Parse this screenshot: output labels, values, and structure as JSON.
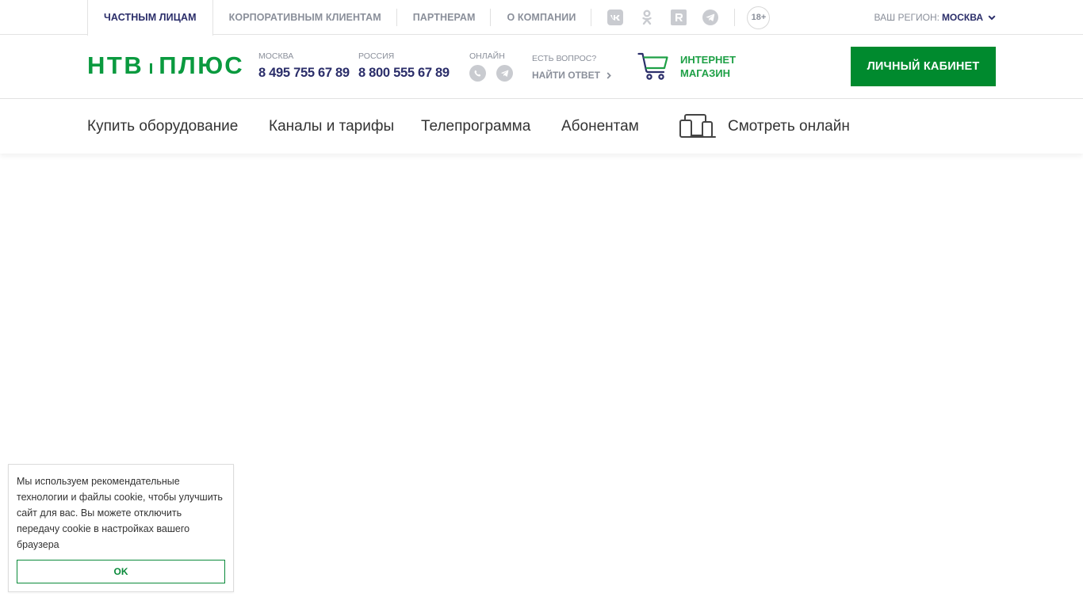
{
  "colors": {
    "brand_green": "#0a9a3f",
    "button_green": "#008a2e",
    "navy": "#2b2e6a",
    "muted": "#8a8f9a"
  },
  "topbar": {
    "nav": [
      {
        "label": "Частным лицам",
        "active": true
      },
      {
        "label": "Корпоративным клиентам",
        "active": false
      },
      {
        "label": "Партнерам",
        "active": false
      },
      {
        "label": "О компании",
        "active": false
      }
    ],
    "socials": [
      "vk-icon",
      "odnoklassniki-icon",
      "rutube-icon",
      "telegram-icon"
    ],
    "age_badge": "18+",
    "region_label": "Ваш регион:",
    "region_value": "Москва"
  },
  "header": {
    "logo_left": "НТВ",
    "logo_right": "ПЛЮС",
    "phones": [
      {
        "label": "Москва",
        "number": "8 495 755 67 89"
      },
      {
        "label": "Россия",
        "number": "8 800 555 67 89"
      }
    ],
    "online_label": "Онлайн",
    "online_icons": [
      "whatsapp-icon",
      "telegram-icon"
    ],
    "question_label": "Есть вопрос?",
    "question_link": "Найти ответ",
    "shop_line1": "Интернет",
    "shop_line2": "магазин",
    "cabinet_button": "Личный кабинет"
  },
  "mainnav": {
    "items": [
      {
        "label": "Купить оборудование"
      },
      {
        "label": "Каналы и тарифы"
      },
      {
        "label": "Телепрограмма"
      },
      {
        "label": "Абонентам"
      },
      {
        "label": "Смотреть онлайн",
        "icon": "devices-icon"
      }
    ]
  },
  "cookie": {
    "text": "Мы используем рекомендательные технологии и файлы cookie, чтобы улучшить сайт для вас. Вы можете отключить передачу cookie в настройках вашего браузера",
    "ok_label": "OK"
  }
}
